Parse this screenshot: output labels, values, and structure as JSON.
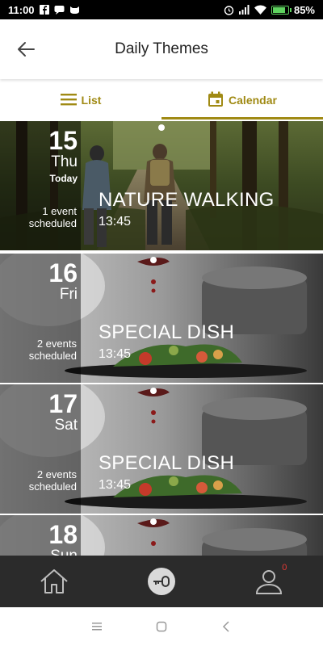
{
  "status_bar": {
    "time": "11:00",
    "battery_level": "85%",
    "battery_fraction": 0.85,
    "left_icons": [
      "facebook-icon",
      "message-icon",
      "cat-icon"
    ],
    "right_icons": [
      "alarm-icon",
      "signal-icon",
      "wifi-icon",
      "battery-icon"
    ]
  },
  "header": {
    "title": "Daily Themes",
    "back_icon": "back-arrow-icon"
  },
  "tabs": [
    {
      "label": "List",
      "icon": "list-icon",
      "active": false
    },
    {
      "label": "Calendar",
      "icon": "calendar-icon",
      "active": true
    }
  ],
  "colors": {
    "accent": "#a08a14",
    "status_bar_bg": "#000000",
    "bottom_nav_bg": "#2b2b2b",
    "badge": "#e53935"
  },
  "days": [
    {
      "day": "15",
      "weekday": "Thu",
      "today_label": "Today",
      "count": "1 event",
      "count_suffix": "scheduled",
      "event_title": "NATURE WALKING",
      "event_time": "13:45",
      "image": "forest-hikers-photo"
    },
    {
      "day": "16",
      "weekday": "Fri",
      "today_label": "",
      "count": "2 events",
      "count_suffix": "scheduled",
      "event_title": "SPECIAL DISH",
      "event_time": "13:45",
      "image": "plated-dish-photo"
    },
    {
      "day": "17",
      "weekday": "Sat",
      "today_label": "",
      "count": "2 events",
      "count_suffix": "scheduled",
      "event_title": "SPECIAL DISH",
      "event_time": "13:45",
      "image": "plated-dish-photo"
    },
    {
      "day": "18",
      "weekday": "Sun",
      "today_label": "",
      "count": "",
      "count_suffix": "",
      "event_title": "",
      "event_time": "",
      "image": "plated-dish-photo"
    }
  ],
  "bottom_nav": {
    "items": [
      "home-icon",
      "key-icon",
      "profile-icon"
    ],
    "profile_badge": "0"
  },
  "system_nav": [
    "recent-apps-icon",
    "home-circle-icon",
    "back-chevron-icon"
  ]
}
